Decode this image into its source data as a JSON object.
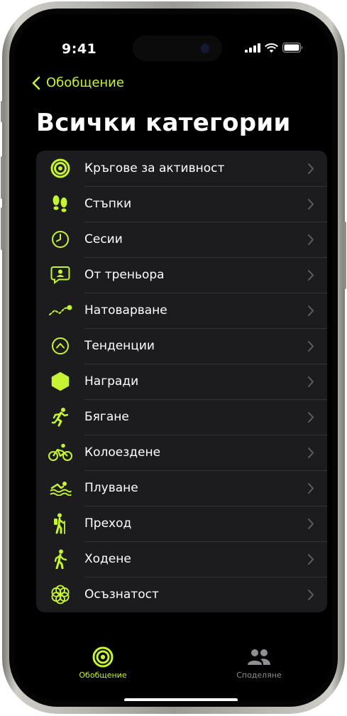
{
  "status": {
    "time": "9:41"
  },
  "nav": {
    "back_label": "Обобщение"
  },
  "page": {
    "title": "Всички категории"
  },
  "categories": [
    {
      "label": "Кръгове за активност",
      "icon": "activity-rings-icon"
    },
    {
      "label": "Стъпки",
      "icon": "footprints-icon"
    },
    {
      "label": "Сесии",
      "icon": "clock-icon"
    },
    {
      "label": "От треньора",
      "icon": "coach-message-icon"
    },
    {
      "label": "Натоварване",
      "icon": "training-load-icon"
    },
    {
      "label": "Тенденции",
      "icon": "trends-icon"
    },
    {
      "label": "Награди",
      "icon": "awards-hexagon-icon"
    },
    {
      "label": "Бягане",
      "icon": "running-icon"
    },
    {
      "label": "Колоездене",
      "icon": "cycling-icon"
    },
    {
      "label": "Плуване",
      "icon": "swimming-icon"
    },
    {
      "label": "Преход",
      "icon": "hiking-icon"
    },
    {
      "label": "Ходене",
      "icon": "walking-icon"
    },
    {
      "label": "Осъзнатост",
      "icon": "mindfulness-icon"
    }
  ],
  "tabs": [
    {
      "label": "Обобщение",
      "icon": "activity-rings-icon",
      "active": true
    },
    {
      "label": "Споделяне",
      "icon": "people-icon",
      "active": false
    }
  ],
  "colors": {
    "accent": "#c6f432",
    "background": "#000000",
    "list_bg": "#1c1c1e",
    "inactive": "#8e8e93"
  }
}
